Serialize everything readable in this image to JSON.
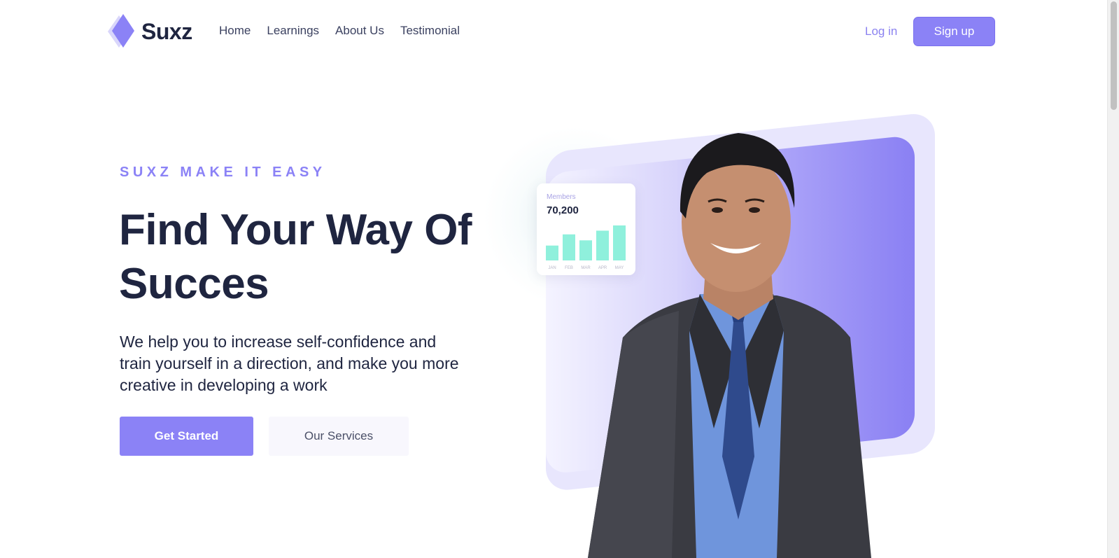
{
  "brand": {
    "name": "Suxz",
    "accent": "#8b82f6",
    "dark": "#1f2540"
  },
  "nav": {
    "items": [
      "Home",
      "Learnings",
      "About Us",
      "Testimonial"
    ]
  },
  "auth": {
    "login_label": "Log in",
    "signup_label": "Sign up"
  },
  "hero": {
    "eyebrow": "SUXZ MAKE IT EASY",
    "headline": "Find Your Way Of Succes",
    "subtext": "We help you to increase self-confidence and train yourself in a direction, and make you more creative in developing a work",
    "primary_cta": "Get Started",
    "secondary_cta": "Our Services"
  },
  "stats_card": {
    "label": "Members",
    "value": "70,200",
    "chart_color": "#8ff0dc",
    "chart_data": {
      "type": "bar",
      "categories": [
        "JAN",
        "FEB",
        "MAR",
        "APR",
        "MAY"
      ],
      "values": [
        20,
        35,
        27,
        40,
        47
      ]
    }
  },
  "icons": [
    "diamond-logo-icon"
  ]
}
